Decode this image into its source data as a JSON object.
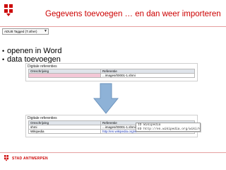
{
  "slide": {
    "title": "Gegevens toevoegen … en dan weer importeren",
    "accent_color": "#cc0000"
  },
  "logo": {
    "icon": "antwerp-hand-logo"
  },
  "toolbar": {
    "value": "ADUB Tagged (T.other)",
    "icon": "dropdown-arrow-icon"
  },
  "bullets": [
    {
      "text": "openen in Word"
    },
    {
      "text": "data toevoegen"
    }
  ],
  "doc_before": {
    "heading": "Digitale referenties",
    "headers": [
      "Omschrijving",
      "Referentie"
    ],
    "rows": [
      {
        "omschrijving": "",
        "referentie": "...images/00001-1.shmi"
      }
    ]
  },
  "arrow": {
    "icon": "down-arrow-icon",
    "color": "#8eb2d7"
  },
  "doc_after": {
    "heading": "Digitale referenties",
    "headers": [
      "Omschrijving",
      "Referentie"
    ],
    "rows": [
      {
        "omschrijving": "shmi",
        "referentie": "...images/00001-1.shmi"
      },
      {
        "omschrijving": "Wikipedia",
        "referentie": "http://en.wikipedia.org/wiki/Heathfield"
      }
    ]
  },
  "popup": {
    "lines": [
      "ID Wikipedia",
      "ED http://en.wikipedia.org/wiki/Heathfield"
    ]
  },
  "footer": {
    "text": "STAD ANTWERPEN"
  }
}
